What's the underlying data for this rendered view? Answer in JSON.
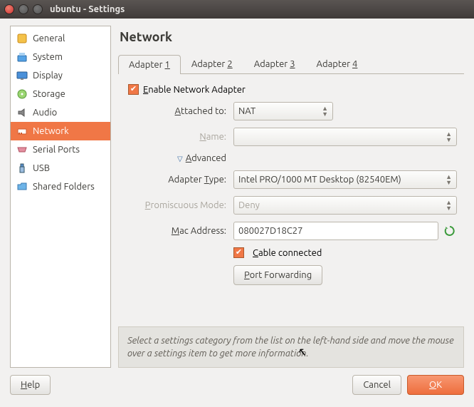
{
  "window": {
    "title": "ubuntu - Settings"
  },
  "sidebar": {
    "items": [
      {
        "label": "General"
      },
      {
        "label": "System"
      },
      {
        "label": "Display"
      },
      {
        "label": "Storage"
      },
      {
        "label": "Audio"
      },
      {
        "label": "Network"
      },
      {
        "label": "Serial Ports"
      },
      {
        "label": "USB"
      },
      {
        "label": "Shared Folders"
      }
    ]
  },
  "heading": "Network",
  "tabs": {
    "t1": "Adapter ",
    "t1n": "1",
    "t2": "Adapter ",
    "t2n": "2",
    "t3": "Adapter ",
    "t3n": "3",
    "t4": "Adapter ",
    "t4n": "4"
  },
  "form": {
    "enable_prefix": "E",
    "enable_text": "nable Network Adapter",
    "attached_prefix": "A",
    "attached_label": "ttached to:",
    "attached_value": "NAT",
    "name_prefix": "N",
    "name_label": "ame:",
    "advanced_prefix": "A",
    "advanced_label": "dvanced",
    "adapter_type_label": "Adapter ",
    "adapter_type_u": "T",
    "adapter_type_suffix": "ype:",
    "adapter_type_value": "Intel PRO/1000 MT Desktop (82540EM)",
    "promiscuous_u": "P",
    "promiscuous_label": "romiscuous Mode:",
    "promiscuous_value": "Deny",
    "mac_u": "M",
    "mac_label": "ac Address:",
    "mac_value": "080027D18C27",
    "cable_u": "C",
    "cable_label": "able connected",
    "port_fwd_u": "P",
    "port_fwd_label": "ort Forwarding"
  },
  "info": "Select a settings category from the list on the left-hand side and move the mouse over a settings item to get more information.",
  "footer": {
    "help_u": "H",
    "help": "elp",
    "cancel": "Cancel",
    "ok_u": "O",
    "ok": "K"
  }
}
